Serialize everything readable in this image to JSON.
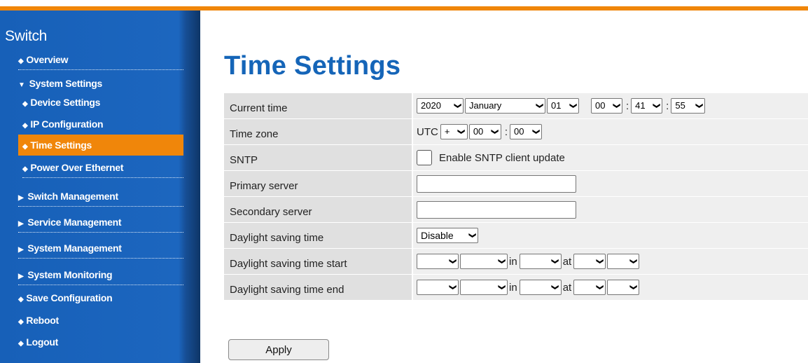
{
  "sidebar": {
    "title": "Switch",
    "items": [
      {
        "label": "Overview",
        "marker": "◆"
      },
      {
        "label": "System Settings",
        "marker": "▼"
      },
      {
        "label": "Device Settings",
        "marker": "◆"
      },
      {
        "label": "IP Configuration",
        "marker": "◆"
      },
      {
        "label": "Time Settings",
        "marker": "◆"
      },
      {
        "label": "Power Over Ethernet",
        "marker": "◆"
      },
      {
        "label": "Switch Management",
        "marker": "▶"
      },
      {
        "label": "Service Management",
        "marker": "▶"
      },
      {
        "label": "System Management",
        "marker": "▶"
      },
      {
        "label": "System Monitoring",
        "marker": "▶"
      },
      {
        "label": "Save Configuration",
        "marker": "◆"
      },
      {
        "label": "Reboot",
        "marker": "◆"
      },
      {
        "label": "Logout",
        "marker": "◆"
      }
    ],
    "active_item": "Time Settings"
  },
  "page": {
    "title": "Time Settings"
  },
  "form": {
    "current_time": {
      "label": "Current time",
      "year": "2020",
      "month": "January",
      "day": "01",
      "hour": "00",
      "minute": "41",
      "second": "55",
      "sep": ":"
    },
    "time_zone": {
      "label": "Time zone",
      "prefix": "UTC",
      "sign": "+",
      "hours": "00",
      "minutes": "00",
      "sep": ":"
    },
    "sntp": {
      "label": "SNTP",
      "checkbox_label": "Enable SNTP client update",
      "checked": false
    },
    "primary_server": {
      "label": "Primary server",
      "value": ""
    },
    "secondary_server": {
      "label": "Secondary server",
      "value": ""
    },
    "dst": {
      "label": "Daylight saving time",
      "value": "Disable"
    },
    "dst_start": {
      "label": "Daylight saving time start",
      "in_text": "in",
      "at_text": "at"
    },
    "dst_end": {
      "label": "Daylight saving time end",
      "in_text": "in",
      "at_text": "at"
    }
  },
  "buttons": {
    "apply": "Apply"
  },
  "colors": {
    "accent_orange": "#f0860a",
    "sidebar_blue": "#1c66bf",
    "title_blue": "#1565b8"
  }
}
